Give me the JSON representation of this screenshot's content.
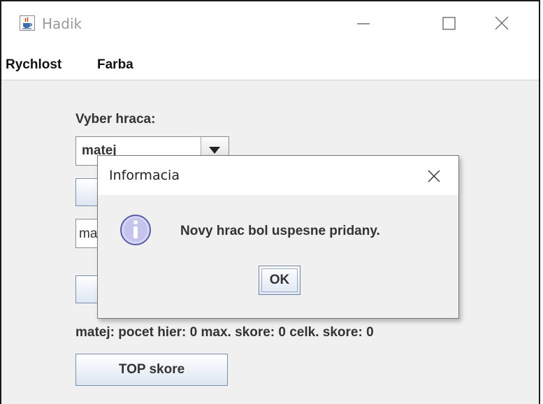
{
  "window": {
    "title": "Hadik",
    "icon": "java-cup-icon",
    "controls": [
      "minimize-icon",
      "maximize-icon",
      "close-icon"
    ]
  },
  "menubar": {
    "items": [
      "Rychlost",
      "Farba"
    ]
  },
  "form": {
    "select_label": "Vyber hraca:",
    "selected_player": "matej",
    "name_field_value": "matej",
    "stats_text": "matej: pocet hier: 0 max. skore: 0 celk. skore: 0",
    "top_button": "TOP skore"
  },
  "dialog": {
    "title": "Informacia",
    "icon": "info-icon",
    "message": "Novy hrac bol uspesne pridany.",
    "ok_label": "OK"
  },
  "colors": {
    "window_bg": "#f0f0f0",
    "button_gradient_bottom": "#dde6f2",
    "info_icon_fill": "#c8c8f0"
  }
}
